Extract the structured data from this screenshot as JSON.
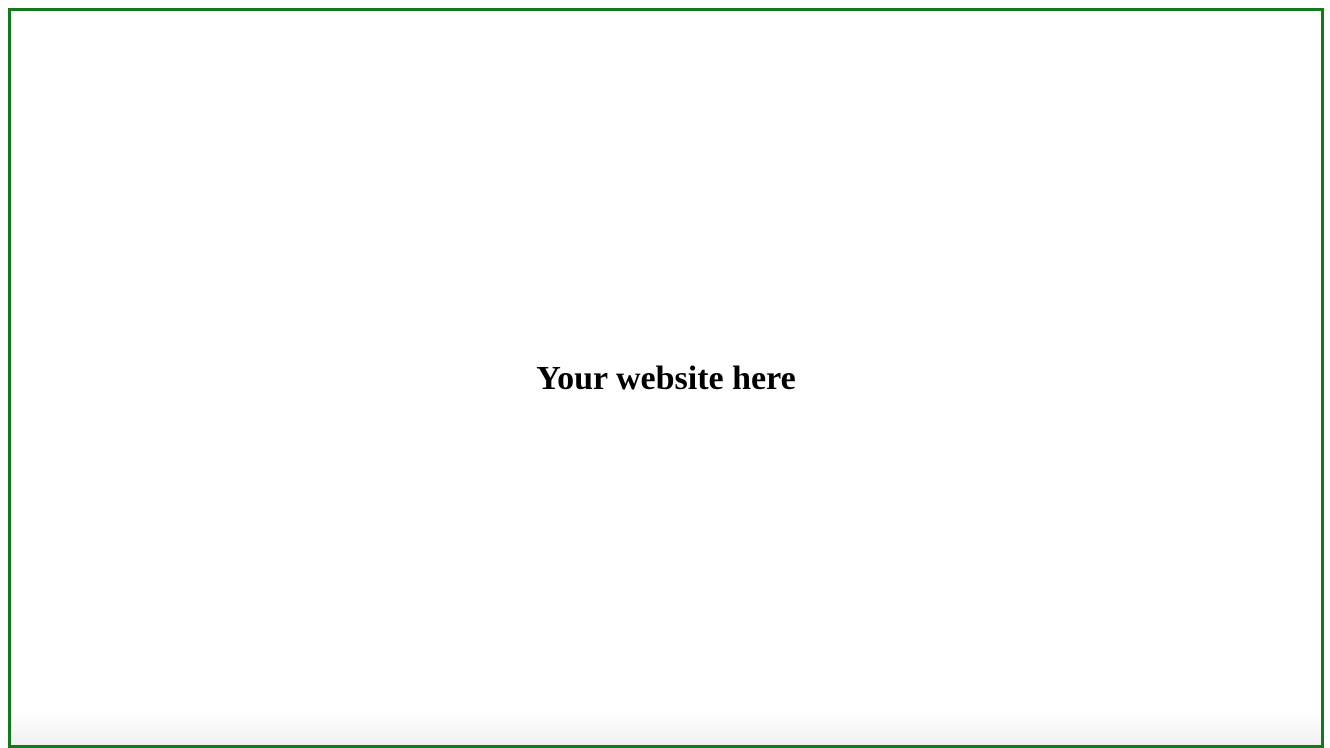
{
  "page": {
    "heading": "Your website here"
  },
  "colors": {
    "frame_border": "#127a1c",
    "background": "#ffffff",
    "text": "#000000"
  }
}
